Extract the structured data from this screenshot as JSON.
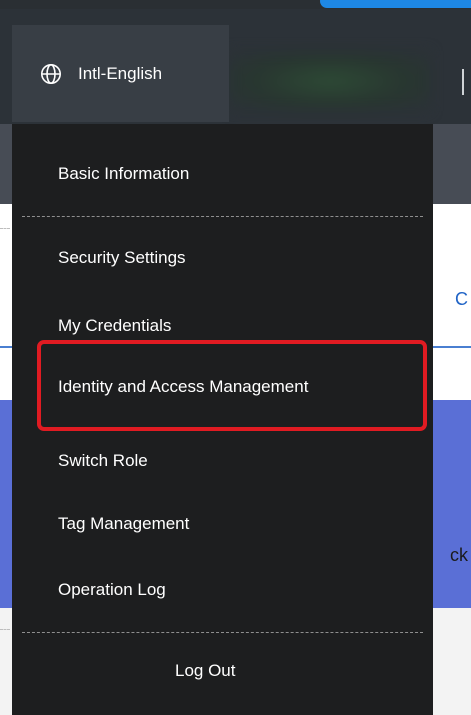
{
  "header": {
    "language_label": "Intl-English",
    "language_icon": "globe-icon"
  },
  "menu": {
    "items": [
      {
        "label": "Basic Information"
      },
      {
        "label": "Security Settings"
      },
      {
        "label": "My Credentials"
      },
      {
        "label": "Identity and Access Management",
        "highlighted": true
      },
      {
        "label": "Switch Role"
      },
      {
        "label": "Tag Management"
      },
      {
        "label": "Operation Log"
      }
    ],
    "logout_label": "Log Out"
  },
  "background": {
    "partial_text_1": "C",
    "partial_text_2": "ck"
  },
  "colors": {
    "menu_bg": "#1d1e1f",
    "header_bg": "#2c3238",
    "highlight_border": "#e01b22",
    "link_blue": "#1f63c6",
    "banner_blue": "#5a6fd6"
  }
}
